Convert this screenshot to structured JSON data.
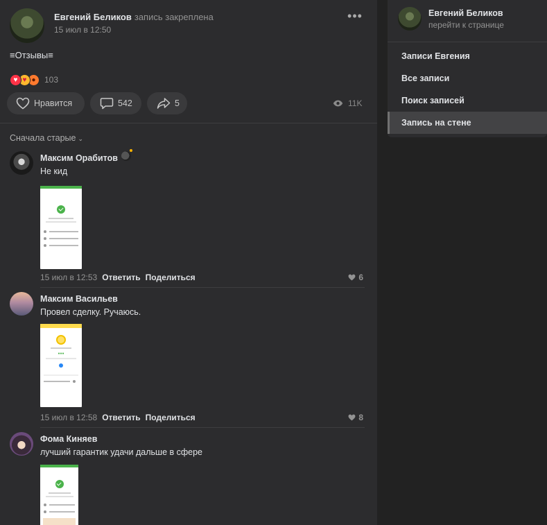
{
  "post": {
    "author": "Евгений Беликов",
    "pinned_note": "запись закреплена",
    "date": "15 июл в 12:50",
    "more_icon": "•••",
    "text": "≡Отзывы≡",
    "reactions_count": "103",
    "like_label": "Нравится",
    "comments_count": "542",
    "shares_count": "5",
    "views_count": "11K"
  },
  "comments": {
    "sort_label": "Сначала старые",
    "items": [
      {
        "name": "Максим Орабитов",
        "text": "Не кид",
        "date": "15 июл в 12:53",
        "reply": "Ответить",
        "share": "Поделиться",
        "likes": "6"
      },
      {
        "name": "Максим Васильев",
        "text": "Провел сделку. Ручаюсь.",
        "date": "15 июл в 12:58",
        "reply": "Ответить",
        "share": "Поделиться",
        "likes": "8"
      },
      {
        "name": "Фома Киняев",
        "text": "лучший гарантик удачи дальше в сфере"
      }
    ]
  },
  "sidebar": {
    "name": "Евгений Беликов",
    "sub": "перейти к странице",
    "items": [
      {
        "label": "Записи Евгения"
      },
      {
        "label": "Все записи"
      },
      {
        "label": "Поиск записей"
      },
      {
        "label": "Запись на стене"
      }
    ]
  },
  "colors": {
    "background": "#222222",
    "panel": "#2c2c2e",
    "text": "#e1e3e6",
    "secondary": "#939393",
    "reaction_heart": "#ff3347",
    "success_green": "#4bb34b"
  }
}
